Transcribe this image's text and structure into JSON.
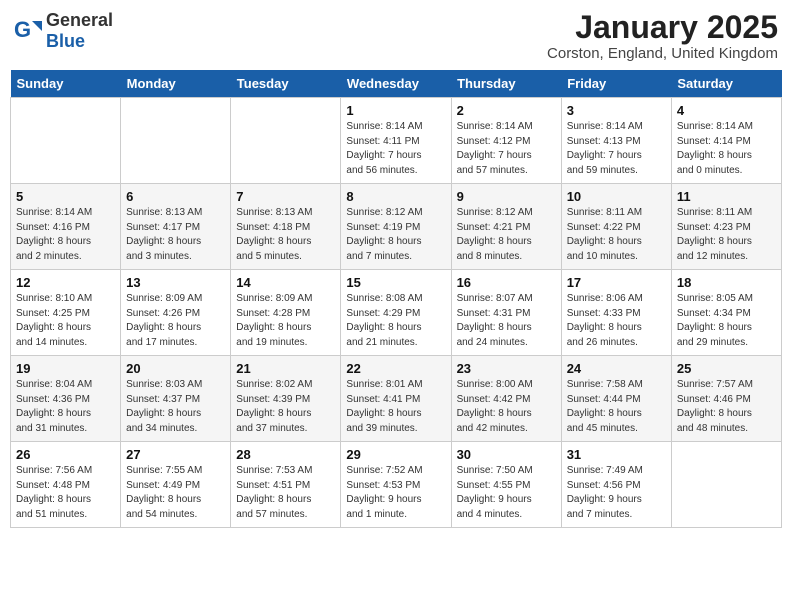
{
  "header": {
    "logo_general": "General",
    "logo_blue": "Blue",
    "month_title": "January 2025",
    "location": "Corston, England, United Kingdom"
  },
  "weekdays": [
    "Sunday",
    "Monday",
    "Tuesday",
    "Wednesday",
    "Thursday",
    "Friday",
    "Saturday"
  ],
  "weeks": [
    [
      {
        "day": "",
        "info": ""
      },
      {
        "day": "",
        "info": ""
      },
      {
        "day": "",
        "info": ""
      },
      {
        "day": "1",
        "info": "Sunrise: 8:14 AM\nSunset: 4:11 PM\nDaylight: 7 hours\nand 56 minutes."
      },
      {
        "day": "2",
        "info": "Sunrise: 8:14 AM\nSunset: 4:12 PM\nDaylight: 7 hours\nand 57 minutes."
      },
      {
        "day": "3",
        "info": "Sunrise: 8:14 AM\nSunset: 4:13 PM\nDaylight: 7 hours\nand 59 minutes."
      },
      {
        "day": "4",
        "info": "Sunrise: 8:14 AM\nSunset: 4:14 PM\nDaylight: 8 hours\nand 0 minutes."
      }
    ],
    [
      {
        "day": "5",
        "info": "Sunrise: 8:14 AM\nSunset: 4:16 PM\nDaylight: 8 hours\nand 2 minutes."
      },
      {
        "day": "6",
        "info": "Sunrise: 8:13 AM\nSunset: 4:17 PM\nDaylight: 8 hours\nand 3 minutes."
      },
      {
        "day": "7",
        "info": "Sunrise: 8:13 AM\nSunset: 4:18 PM\nDaylight: 8 hours\nand 5 minutes."
      },
      {
        "day": "8",
        "info": "Sunrise: 8:12 AM\nSunset: 4:19 PM\nDaylight: 8 hours\nand 7 minutes."
      },
      {
        "day": "9",
        "info": "Sunrise: 8:12 AM\nSunset: 4:21 PM\nDaylight: 8 hours\nand 8 minutes."
      },
      {
        "day": "10",
        "info": "Sunrise: 8:11 AM\nSunset: 4:22 PM\nDaylight: 8 hours\nand 10 minutes."
      },
      {
        "day": "11",
        "info": "Sunrise: 8:11 AM\nSunset: 4:23 PM\nDaylight: 8 hours\nand 12 minutes."
      }
    ],
    [
      {
        "day": "12",
        "info": "Sunrise: 8:10 AM\nSunset: 4:25 PM\nDaylight: 8 hours\nand 14 minutes."
      },
      {
        "day": "13",
        "info": "Sunrise: 8:09 AM\nSunset: 4:26 PM\nDaylight: 8 hours\nand 17 minutes."
      },
      {
        "day": "14",
        "info": "Sunrise: 8:09 AM\nSunset: 4:28 PM\nDaylight: 8 hours\nand 19 minutes."
      },
      {
        "day": "15",
        "info": "Sunrise: 8:08 AM\nSunset: 4:29 PM\nDaylight: 8 hours\nand 21 minutes."
      },
      {
        "day": "16",
        "info": "Sunrise: 8:07 AM\nSunset: 4:31 PM\nDaylight: 8 hours\nand 24 minutes."
      },
      {
        "day": "17",
        "info": "Sunrise: 8:06 AM\nSunset: 4:33 PM\nDaylight: 8 hours\nand 26 minutes."
      },
      {
        "day": "18",
        "info": "Sunrise: 8:05 AM\nSunset: 4:34 PM\nDaylight: 8 hours\nand 29 minutes."
      }
    ],
    [
      {
        "day": "19",
        "info": "Sunrise: 8:04 AM\nSunset: 4:36 PM\nDaylight: 8 hours\nand 31 minutes."
      },
      {
        "day": "20",
        "info": "Sunrise: 8:03 AM\nSunset: 4:37 PM\nDaylight: 8 hours\nand 34 minutes."
      },
      {
        "day": "21",
        "info": "Sunrise: 8:02 AM\nSunset: 4:39 PM\nDaylight: 8 hours\nand 37 minutes."
      },
      {
        "day": "22",
        "info": "Sunrise: 8:01 AM\nSunset: 4:41 PM\nDaylight: 8 hours\nand 39 minutes."
      },
      {
        "day": "23",
        "info": "Sunrise: 8:00 AM\nSunset: 4:42 PM\nDaylight: 8 hours\nand 42 minutes."
      },
      {
        "day": "24",
        "info": "Sunrise: 7:58 AM\nSunset: 4:44 PM\nDaylight: 8 hours\nand 45 minutes."
      },
      {
        "day": "25",
        "info": "Sunrise: 7:57 AM\nSunset: 4:46 PM\nDaylight: 8 hours\nand 48 minutes."
      }
    ],
    [
      {
        "day": "26",
        "info": "Sunrise: 7:56 AM\nSunset: 4:48 PM\nDaylight: 8 hours\nand 51 minutes."
      },
      {
        "day": "27",
        "info": "Sunrise: 7:55 AM\nSunset: 4:49 PM\nDaylight: 8 hours\nand 54 minutes."
      },
      {
        "day": "28",
        "info": "Sunrise: 7:53 AM\nSunset: 4:51 PM\nDaylight: 8 hours\nand 57 minutes."
      },
      {
        "day": "29",
        "info": "Sunrise: 7:52 AM\nSunset: 4:53 PM\nDaylight: 9 hours\nand 1 minute."
      },
      {
        "day": "30",
        "info": "Sunrise: 7:50 AM\nSunset: 4:55 PM\nDaylight: 9 hours\nand 4 minutes."
      },
      {
        "day": "31",
        "info": "Sunrise: 7:49 AM\nSunset: 4:56 PM\nDaylight: 9 hours\nand 7 minutes."
      },
      {
        "day": "",
        "info": ""
      }
    ]
  ]
}
